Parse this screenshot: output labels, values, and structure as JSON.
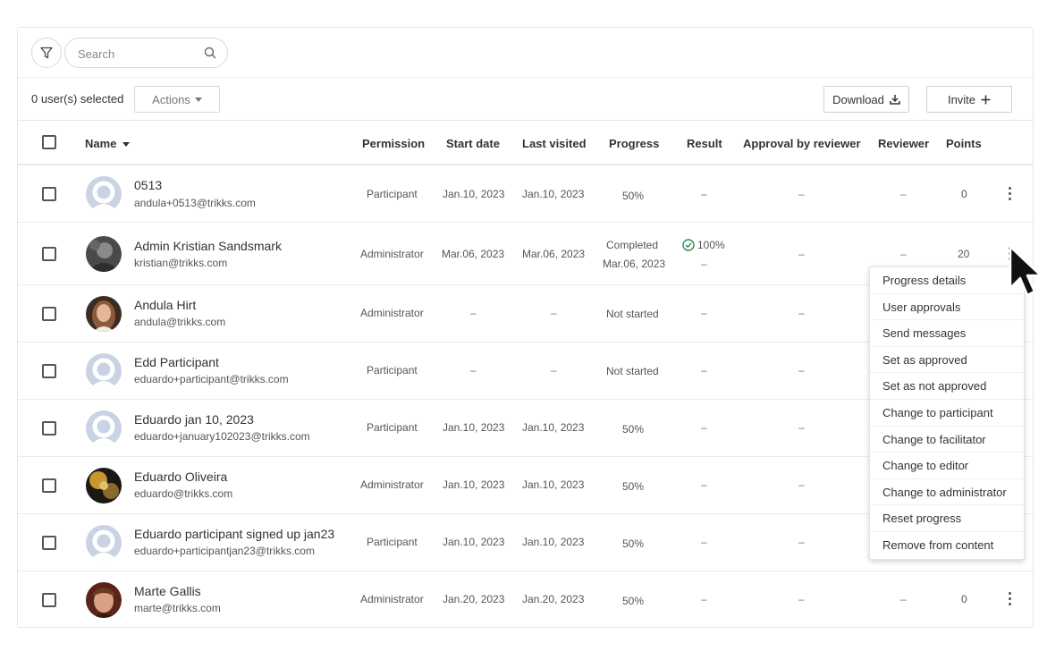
{
  "toolbar": {
    "search_placeholder": "Search"
  },
  "actionbar": {
    "selected_count": "0 user(s) selected",
    "actions_label": "Actions",
    "download_label": "Download",
    "invite_label": "Invite"
  },
  "columns": {
    "name": "Name",
    "permission": "Permission",
    "start_date": "Start date",
    "last_visited": "Last visited",
    "progress": "Progress",
    "result": "Result",
    "approval": "Approval by reviewer",
    "reviewer": "Reviewer",
    "points": "Points"
  },
  "rows": [
    {
      "name": "0513",
      "email": "andula+0513@trikks.com",
      "permission": "Participant",
      "start_date": "Jan.10, 2023",
      "last_visited": "Jan.10, 2023",
      "progress": "50%",
      "result": "–",
      "approval": "–",
      "reviewer": "–",
      "points": "0",
      "avatar": "placeholder"
    },
    {
      "name": "Admin Kristian Sandsmark",
      "email": "kristian@trikks.com",
      "permission": "Administrator",
      "start_date": "Mar.06, 2023",
      "last_visited": "Mar.06, 2023",
      "progress": "Completed",
      "progress_date": "Mar.06, 2023",
      "result": "100%",
      "result_sub": "–",
      "approval": "–",
      "reviewer": "–",
      "points": "20",
      "avatar": "photo-dark"
    },
    {
      "name": "Andula Hirt",
      "email": "andula@trikks.com",
      "permission": "Administrator",
      "start_date": "–",
      "last_visited": "–",
      "progress": "Not started",
      "result": "–",
      "approval": "–",
      "avatar": "photo-woman"
    },
    {
      "name": "Edd Participant",
      "email": "eduardo+participant@trikks.com",
      "permission": "Participant",
      "start_date": "–",
      "last_visited": "–",
      "progress": "Not started",
      "result": "–",
      "approval": "–",
      "avatar": "placeholder"
    },
    {
      "name": "Eduardo jan 10, 2023",
      "email": "eduardo+january102023@trikks.com",
      "permission": "Participant",
      "start_date": "Jan.10, 2023",
      "last_visited": "Jan.10, 2023",
      "progress": "50%",
      "result": "–",
      "approval": "–",
      "avatar": "placeholder"
    },
    {
      "name": "Eduardo Oliveira",
      "email": "eduardo@trikks.com",
      "permission": "Administrator",
      "start_date": "Jan.10, 2023",
      "last_visited": "Jan.10, 2023",
      "progress": "50%",
      "result": "–",
      "approval": "–",
      "avatar": "photo-gold"
    },
    {
      "name": "Eduardo participant signed up jan23",
      "email": "eduardo+participantjan23@trikks.com",
      "permission": "Participant",
      "start_date": "Jan.10, 2023",
      "last_visited": "Jan.10, 2023",
      "progress": "50%",
      "result": "–",
      "approval": "–",
      "avatar": "placeholder"
    },
    {
      "name": "Marte Gallis",
      "email": "marte@trikks.com",
      "permission": "Administrator",
      "start_date": "Jan.20, 2023",
      "last_visited": "Jan.20, 2023",
      "progress": "50%",
      "result": "–",
      "approval": "–",
      "reviewer": "–",
      "points": "0",
      "avatar": "photo-red"
    }
  ],
  "context_menu": {
    "items": [
      "Progress details",
      "User approvals",
      "Send messages",
      "Set as approved",
      "Set as not approved",
      "Change to participant",
      "Change to facilitator",
      "Change to editor",
      "Change to administrator",
      "Reset progress",
      "Remove from content"
    ]
  },
  "colors": {
    "border": "#e6e6e6",
    "success": "#2e8b57",
    "placeholder_avatar_bg": "#c9d3e4",
    "placeholder_avatar_fg": "#ffffff"
  }
}
